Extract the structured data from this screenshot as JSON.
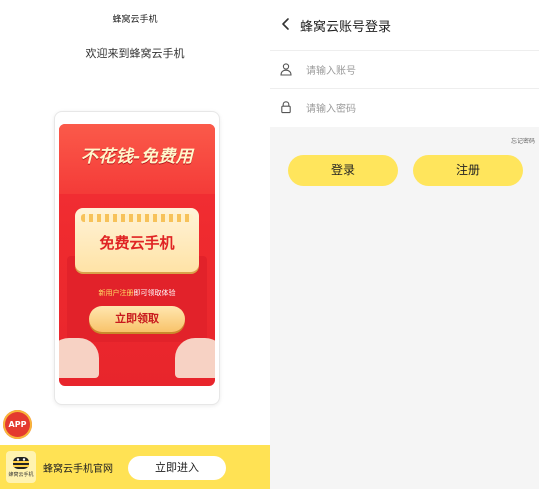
{
  "left": {
    "app_title": "蜂窝云手机",
    "welcome": "欢迎来到蜂窝云手机",
    "promo": {
      "slogan": "不花钱-免费用",
      "ticket_text": "免费云手机",
      "sub_highlight": "新用户注册",
      "sub_rest": "即可领取体验",
      "claim_label": "立即领取"
    },
    "app_badge": "APP",
    "bottom_bar": {
      "logo_caption": "蜂窝云手机",
      "name": "蜂窝云手机官网",
      "enter_label": "立即进入"
    }
  },
  "right": {
    "header": {
      "title": "蜂窝云账号登录",
      "back_icon": "chevron-left-icon"
    },
    "account": {
      "placeholder": "请输入账号",
      "value": "",
      "icon": "user-icon"
    },
    "password": {
      "placeholder": "请输入密码",
      "value": "",
      "icon": "lock-icon"
    },
    "forgot_label": "忘记密码",
    "login_label": "登录",
    "register_label": "注册"
  },
  "colors": {
    "accent_yellow": "#ffe55c",
    "bar_yellow": "#ffe254",
    "promo_red": "#ef2b2f",
    "page_gray": "#f5f5f5"
  }
}
